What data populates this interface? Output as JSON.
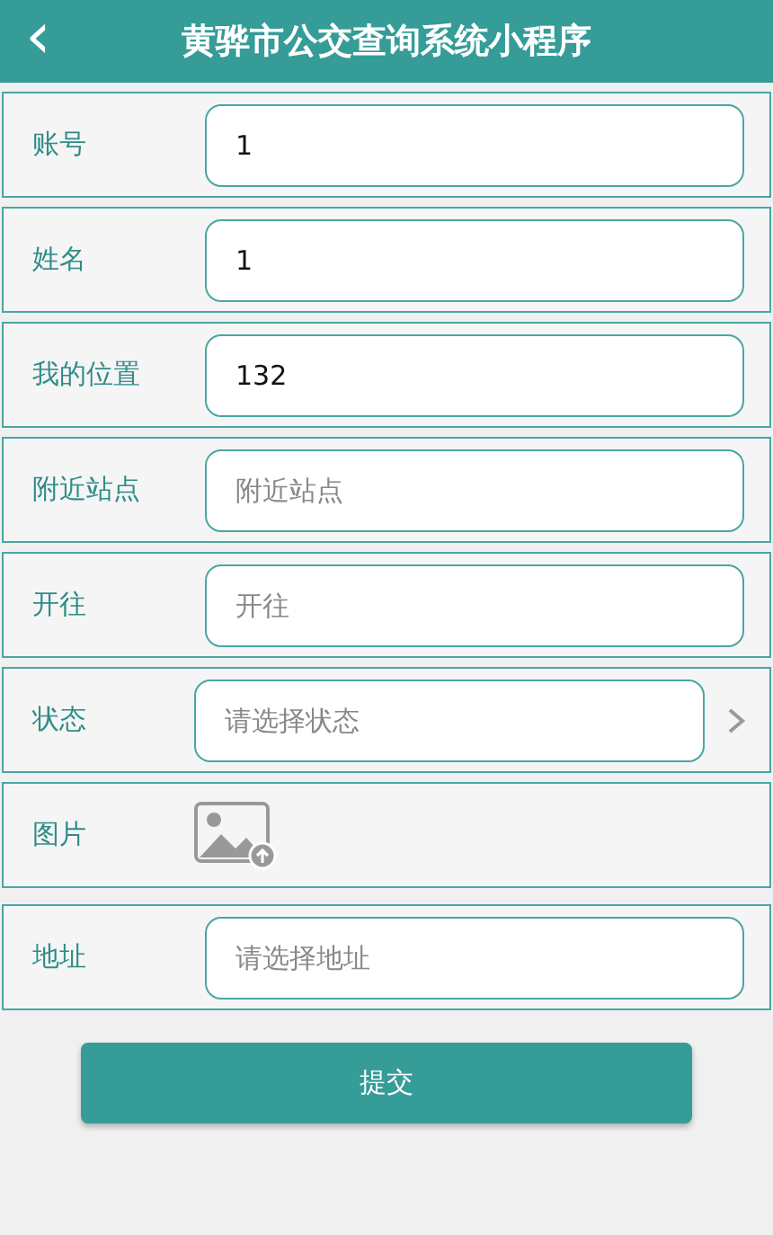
{
  "header": {
    "title": "黄骅市公交查询系统小程序",
    "back": "‹"
  },
  "fields": [
    {
      "kind": "text",
      "label": "账号",
      "value": "1"
    },
    {
      "kind": "text",
      "label": "姓名",
      "value": "1"
    },
    {
      "kind": "text",
      "label": "我的位置",
      "value": "132"
    },
    {
      "kind": "text",
      "label": "附近站点",
      "placeholder": "附近站点"
    },
    {
      "kind": "text",
      "label": "开往",
      "placeholder": "开往"
    },
    {
      "kind": "select",
      "label": "状态",
      "placeholder": "请选择状态"
    },
    {
      "kind": "image",
      "label": "图片"
    },
    {
      "kind": "text",
      "label": "地址",
      "placeholder": "请选择地址"
    }
  ],
  "submit": "提交"
}
